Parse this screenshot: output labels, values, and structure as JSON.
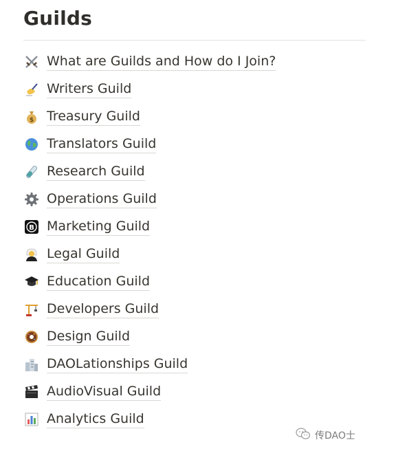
{
  "page": {
    "title": "Guilds"
  },
  "guilds": [
    {
      "icon": "crossed-swords-icon",
      "label": "What are Guilds and How do I Join?"
    },
    {
      "icon": "writing-hand-icon",
      "label": "Writers Guild"
    },
    {
      "icon": "money-bag-icon",
      "label": "Treasury Guild"
    },
    {
      "icon": "globe-icon",
      "label": "Translators Guild"
    },
    {
      "icon": "test-tube-icon",
      "label": "Research Guild"
    },
    {
      "icon": "gear-icon",
      "label": "Operations Guild"
    },
    {
      "icon": "bitcoin-icon",
      "label": "Marketing Guild"
    },
    {
      "icon": "judge-icon",
      "label": "Legal Guild"
    },
    {
      "icon": "graduation-cap-icon",
      "label": "Education Guild"
    },
    {
      "icon": "crane-icon",
      "label": "Developers Guild"
    },
    {
      "icon": "donut-icon",
      "label": "Design Guild"
    },
    {
      "icon": "buildings-icon",
      "label": "DAOLationships Guild"
    },
    {
      "icon": "clapper-board-icon",
      "label": "AudioVisual Guild"
    },
    {
      "icon": "bar-chart-icon",
      "label": "Analytics Guild"
    }
  ],
  "watermark": {
    "icon": "wechat-icon",
    "text": "传DAO士"
  }
}
